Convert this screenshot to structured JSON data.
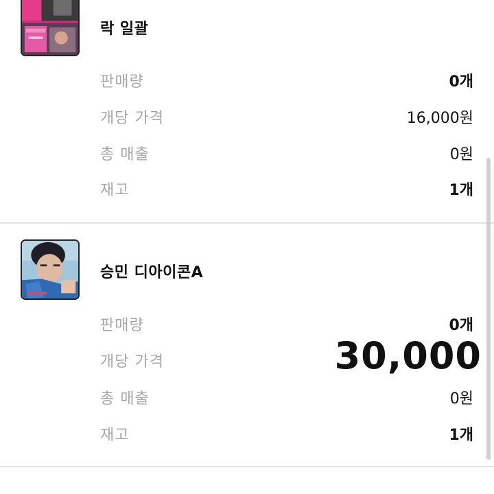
{
  "products": [
    {
      "name": "락 일괄",
      "image_desc": "album-cover-pink",
      "stats": [
        {
          "label": "판매량",
          "value": "0개"
        },
        {
          "label": "개당 가격",
          "value": "16,000원"
        },
        {
          "label": "총 매출",
          "value": "0원"
        },
        {
          "label": "재고",
          "value": "1개"
        }
      ]
    },
    {
      "name": "승민 디아이콘A",
      "image_desc": "photo-card-blue",
      "stats": [
        {
          "label": "판매량",
          "value": "0개"
        },
        {
          "label": "개당 가격",
          "value": "30,000"
        },
        {
          "label": "총 매출",
          "value": "0원"
        },
        {
          "label": "재고",
          "value": "1개"
        }
      ]
    }
  ],
  "colors": {
    "label_gray": "#a8a8a8",
    "value_black": "#111111",
    "divider": "#e2e2e2"
  }
}
